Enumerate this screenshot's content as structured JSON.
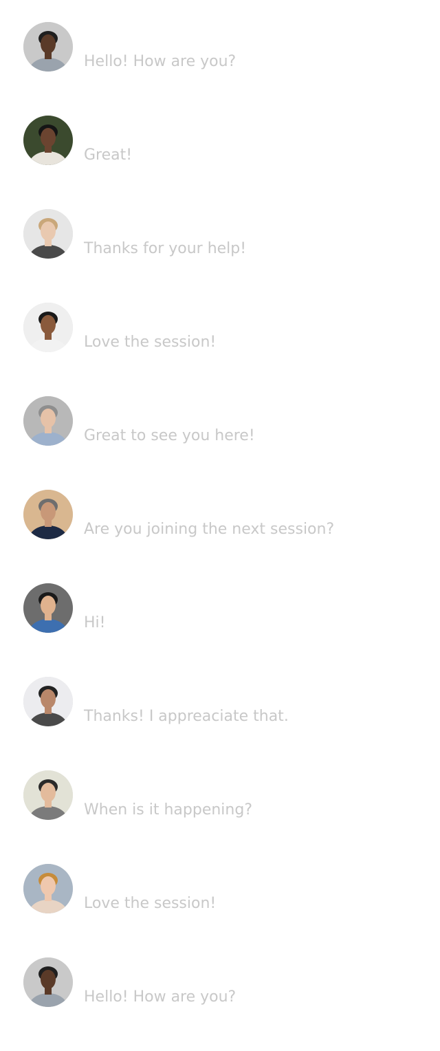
{
  "messages": [
    {
      "text": "Hello! How are you?",
      "avatar": {
        "bg": "#c9c9c9",
        "skin": "#5a3a28",
        "hair": "#1f1f1f",
        "shirt": "#9aa3ad"
      }
    },
    {
      "text": "Great!",
      "avatar": {
        "bg": "#3b4a2e",
        "skin": "#6b4430",
        "hair": "#151515",
        "shirt": "#e8e4dc"
      }
    },
    {
      "text": "Thanks for your help!",
      "avatar": {
        "bg": "#e6e6e6",
        "skin": "#e9c9b0",
        "hair": "#c9a77a",
        "shirt": "#4a4a4a"
      }
    },
    {
      "text": "Love the session!",
      "avatar": {
        "bg": "#efefef",
        "skin": "#8a5a3c",
        "hair": "#1a1a1a",
        "shirt": "#f2f2f2"
      }
    },
    {
      "text": "Great to see you here!",
      "avatar": {
        "bg": "#b8b8b8",
        "skin": "#e6c2a8",
        "hair": "#8e8e8e",
        "shirt": "#9db1cc"
      }
    },
    {
      "text": "Are you joining the next session?",
      "avatar": {
        "bg": "#d9b790",
        "skin": "#c89878",
        "hair": "#6e6e6e",
        "shirt": "#1d2a44"
      }
    },
    {
      "text": "Hi!",
      "avatar": {
        "bg": "#6d6d6d",
        "skin": "#e0b28e",
        "hair": "#1a1a1a",
        "shirt": "#3d6fb0"
      }
    },
    {
      "text": "Thanks! I appreaciate that.",
      "avatar": {
        "bg": "#ececef",
        "skin": "#b9876a",
        "hair": "#222222",
        "shirt": "#4a4a4a"
      }
    },
    {
      "text": "When is it happening?",
      "avatar": {
        "bg": "#e2e2d6",
        "skin": "#e3bb9c",
        "hair": "#2a2a2a",
        "shirt": "#7b7b7b"
      }
    },
    {
      "text": "Love the session!",
      "avatar": {
        "bg": "#a9b6c4",
        "skin": "#efc8ae",
        "hair": "#c78c3a",
        "shirt": "#e8d4c4"
      }
    },
    {
      "text": "Hello! How are you?",
      "avatar": {
        "bg": "#c9c9c9",
        "skin": "#5a3a28",
        "hair": "#1f1f1f",
        "shirt": "#9aa3ad"
      }
    }
  ]
}
